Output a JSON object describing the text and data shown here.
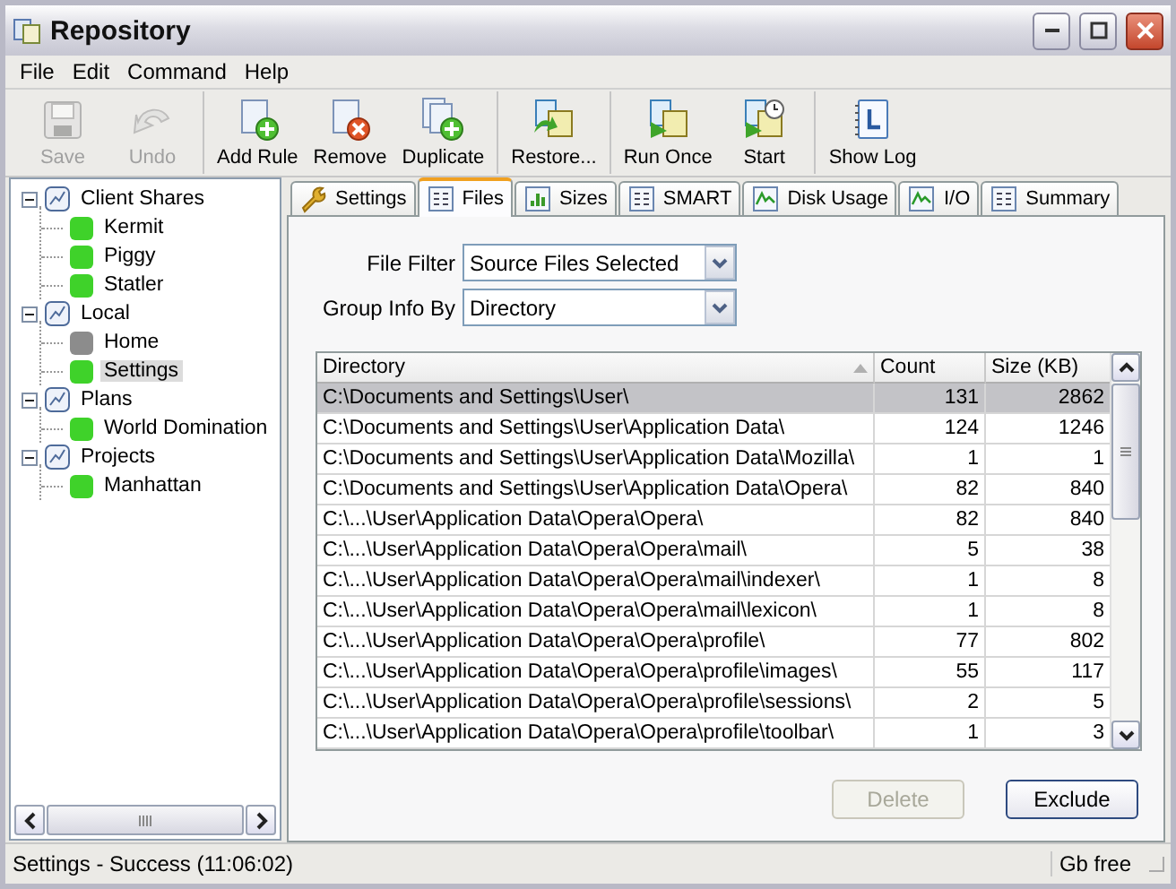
{
  "window": {
    "title": "Repository"
  },
  "menu": [
    {
      "label": "File"
    },
    {
      "label": "Edit"
    },
    {
      "label": "Command"
    },
    {
      "label": "Help"
    }
  ],
  "toolbar": [
    {
      "buttons": [
        {
          "label": "Save",
          "disabled": true
        },
        {
          "label": "Undo",
          "disabled": true
        }
      ]
    },
    {
      "buttons": [
        {
          "label": "Add Rule",
          "disabled": false
        },
        {
          "label": "Remove",
          "disabled": false
        },
        {
          "label": "Duplicate",
          "disabled": false
        }
      ]
    },
    {
      "buttons": [
        {
          "label": "Restore...",
          "disabled": false
        }
      ]
    },
    {
      "buttons": [
        {
          "label": "Run Once",
          "disabled": false
        },
        {
          "label": "Start",
          "disabled": false
        }
      ]
    },
    {
      "buttons": [
        {
          "label": "Show Log",
          "disabled": false
        }
      ]
    }
  ],
  "tree": [
    {
      "label": "Client Shares",
      "expanded": true,
      "selected": false,
      "children": [
        {
          "label": "Kermit",
          "color": "#3fd22a",
          "selected": false
        },
        {
          "label": "Piggy",
          "color": "#3fd22a",
          "selected": false
        },
        {
          "label": "Statler",
          "color": "#3fd22a",
          "selected": false
        }
      ]
    },
    {
      "label": "Local",
      "expanded": true,
      "selected": false,
      "children": [
        {
          "label": "Home",
          "color": "#8c8c8c",
          "selected": false
        },
        {
          "label": "Settings",
          "color": "#3fd22a",
          "selected": true
        }
      ]
    },
    {
      "label": "Plans",
      "expanded": true,
      "selected": false,
      "children": [
        {
          "label": "World Domination",
          "color": "#3fd22a",
          "selected": false
        }
      ]
    },
    {
      "label": "Projects",
      "expanded": true,
      "selected": false,
      "children": [
        {
          "label": "Manhattan",
          "color": "#3fd22a",
          "selected": false
        }
      ]
    }
  ],
  "tabs": [
    {
      "label": "Settings",
      "selected": false
    },
    {
      "label": "Files",
      "selected": true
    },
    {
      "label": "Sizes",
      "selected": false
    },
    {
      "label": "SMART",
      "selected": false
    },
    {
      "label": "Disk Usage",
      "selected": false
    },
    {
      "label": "I/O",
      "selected": false
    },
    {
      "label": "Summary",
      "selected": false
    }
  ],
  "filters": [
    {
      "label": "File Filter",
      "value": "Source Files Selected"
    },
    {
      "label": "Group Info By",
      "value": "Directory"
    }
  ],
  "table": {
    "columns": [
      {
        "label": "Directory",
        "sorted": true
      },
      {
        "label": "Count",
        "sorted": false
      },
      {
        "label": "Size (KB)",
        "sorted": false
      }
    ],
    "rows": [
      {
        "cells": [
          "C:\\Documents and Settings\\User\\",
          "131",
          "2862"
        ],
        "selected": true
      },
      {
        "cells": [
          "C:\\Documents and Settings\\User\\Application Data\\",
          "124",
          "1246"
        ],
        "selected": false
      },
      {
        "cells": [
          "C:\\Documents and Settings\\User\\Application Data\\Mozilla\\",
          "1",
          "1"
        ],
        "selected": false
      },
      {
        "cells": [
          "C:\\Documents and Settings\\User\\Application Data\\Opera\\",
          "82",
          "840"
        ],
        "selected": false
      },
      {
        "cells": [
          "C:\\...\\User\\Application Data\\Opera\\Opera\\",
          "82",
          "840"
        ],
        "selected": false
      },
      {
        "cells": [
          "C:\\...\\User\\Application Data\\Opera\\Opera\\mail\\",
          "5",
          "38"
        ],
        "selected": false
      },
      {
        "cells": [
          "C:\\...\\User\\Application Data\\Opera\\Opera\\mail\\indexer\\",
          "1",
          "8"
        ],
        "selected": false
      },
      {
        "cells": [
          "C:\\...\\User\\Application Data\\Opera\\Opera\\mail\\lexicon\\",
          "1",
          "8"
        ],
        "selected": false
      },
      {
        "cells": [
          "C:\\...\\User\\Application Data\\Opera\\Opera\\profile\\",
          "77",
          "802"
        ],
        "selected": false
      },
      {
        "cells": [
          "C:\\...\\User\\Application Data\\Opera\\Opera\\profile\\images\\",
          "55",
          "117"
        ],
        "selected": false
      },
      {
        "cells": [
          "C:\\...\\User\\Application Data\\Opera\\Opera\\profile\\sessions\\",
          "2",
          "5"
        ],
        "selected": false
      },
      {
        "cells": [
          "C:\\...\\User\\Application Data\\Opera\\Opera\\profile\\toolbar\\",
          "1",
          "3"
        ],
        "selected": false
      }
    ]
  },
  "actions": [
    {
      "label": "Delete",
      "disabled": true
    },
    {
      "label": "Exclude",
      "disabled": false
    }
  ],
  "status_bar": {
    "message": "Settings - Success (11:06:02)",
    "disk": "Gb free"
  }
}
